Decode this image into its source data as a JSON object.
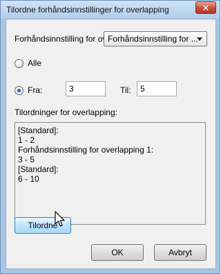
{
  "window": {
    "title": "Tilordne forhåndsinnstillinger for overlapping",
    "close_symbol": "✕"
  },
  "preset": {
    "label": "Forhåndsinnstilling for ov...",
    "selected": "Forhåndsinnstilling for ..."
  },
  "range": {
    "all_label": "Alle",
    "from_label": "Fra:",
    "from_value": "3",
    "to_label": "Til:",
    "to_value": "5",
    "selected": "from"
  },
  "assignments": {
    "label": "Tilordninger for overlapping:",
    "lines": [
      "[Standard]:",
      "1 - 2",
      "Forhåndsinnstilling for overlapping 1:",
      "3 - 5",
      "[Standard]:",
      "6 - 10"
    ]
  },
  "buttons": {
    "assign": "Tilordne",
    "ok": "OK",
    "cancel": "Avbryt"
  }
}
